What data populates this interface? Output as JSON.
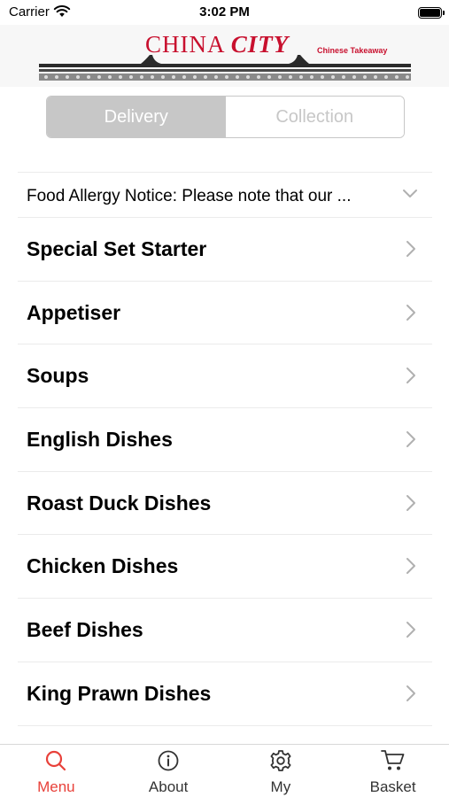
{
  "status_bar": {
    "carrier": "Carrier",
    "time": "3:02 PM",
    "wifi_icon": "wifi-icon",
    "battery_icon": "battery-icon"
  },
  "header": {
    "brand": "CHINA",
    "brand_city": "CITY",
    "tagline": "Chinese Takeaway",
    "accent_color": "#c8102e"
  },
  "segmented": {
    "options": [
      {
        "label": "Delivery",
        "selected": true
      },
      {
        "label": "Collection",
        "selected": false
      }
    ]
  },
  "notice": {
    "text": "Food Allergy Notice: Please note that our ...",
    "icon": "chevron-down-icon"
  },
  "categories": [
    {
      "label": "Special Set Starter"
    },
    {
      "label": "Appetiser"
    },
    {
      "label": "Soups"
    },
    {
      "label": "English Dishes"
    },
    {
      "label": "Roast Duck Dishes"
    },
    {
      "label": "Chicken Dishes"
    },
    {
      "label": "Beef Dishes"
    },
    {
      "label": "King Prawn Dishes"
    }
  ],
  "tabbar": {
    "active_color": "#e8413a",
    "tabs": [
      {
        "label": "Menu",
        "icon": "search-icon",
        "active": true
      },
      {
        "label": "About",
        "icon": "info-icon",
        "active": false
      },
      {
        "label": "My",
        "icon": "gear-icon",
        "active": false
      },
      {
        "label": "Basket",
        "icon": "cart-icon",
        "active": false
      }
    ]
  }
}
